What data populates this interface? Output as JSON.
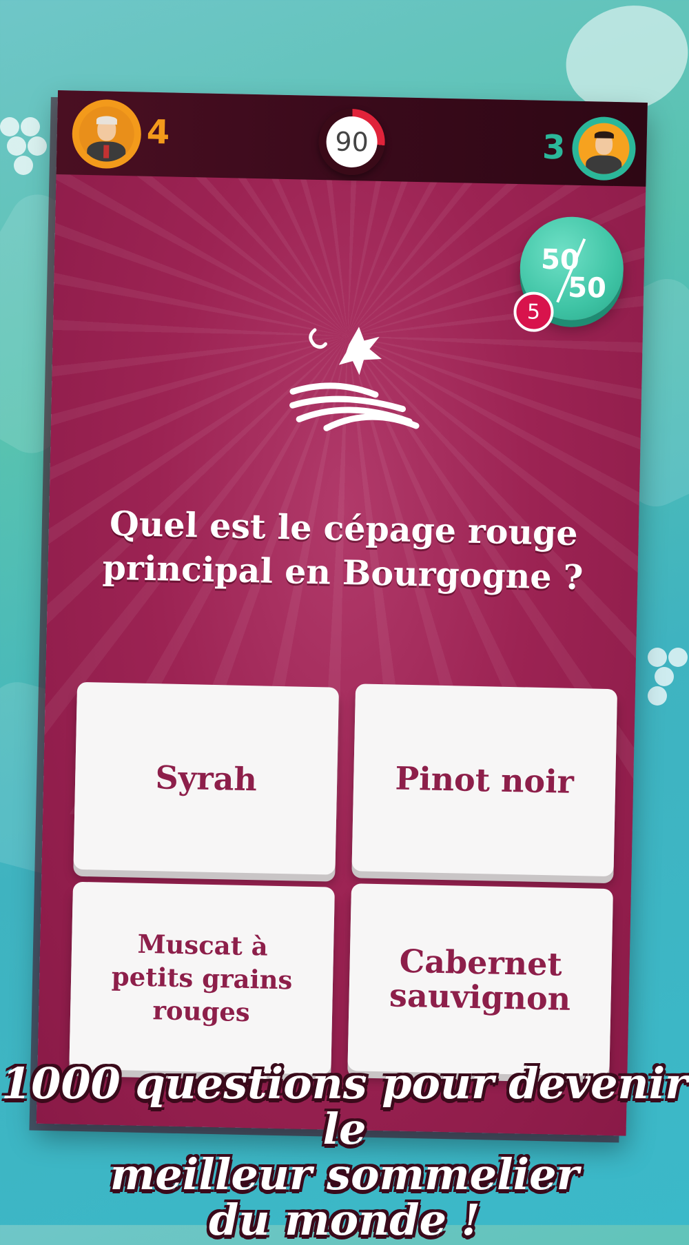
{
  "player1": {
    "score": "4",
    "color": "#f39a1b"
  },
  "player2": {
    "score": "3",
    "color": "#2bb79a"
  },
  "timer": {
    "value": "90"
  },
  "joker": {
    "label_top": "50",
    "label_bottom": "50",
    "remaining": "5"
  },
  "question": {
    "icon": "vineyard-icon",
    "text": "Quel est le cépage rouge principal en Bourgogne ?"
  },
  "answers": [
    {
      "label": "Syrah"
    },
    {
      "label": "Pinot noir"
    },
    {
      "label": "Muscat à petits grains rouges"
    },
    {
      "label": "Cabernet sauvignon"
    }
  ],
  "banner": {
    "line1": "1000 questions pour devenir le",
    "line2": "meilleur sommelier",
    "line3": "du monde !"
  },
  "colors": {
    "card": "#9c2353",
    "answer_text": "#8d1f4a",
    "timer_accent": "#e0233a",
    "joker_bg": "#3fc4a5"
  }
}
